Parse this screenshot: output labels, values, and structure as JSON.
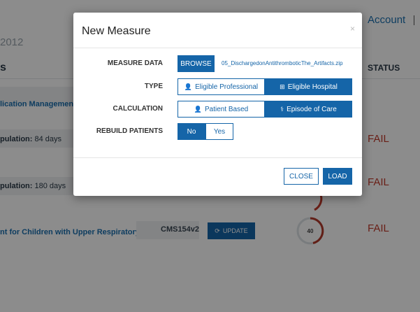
{
  "background": {
    "account_link": "Account",
    "year_fragment": "2012",
    "left_col_fragment": "s",
    "status_header": "STATUS",
    "row1": {
      "title": "lication Management",
      "population": "pulation: 84 days",
      "population_bold": "pulation:",
      "status": "FAIL"
    },
    "row2": {
      "population": "pulation: 180 days",
      "status": "FAIL"
    },
    "row3": {
      "title": "nt for Children with Upper Respiratory",
      "cms": "CMS154v2",
      "update": "UPDATE",
      "gauge": "40",
      "status": "FAIL"
    }
  },
  "modal": {
    "title": "New Measure",
    "close_icon": "×",
    "rows": {
      "measure_data": {
        "label": "MEASURE DATA",
        "browse": "BROWSE",
        "file": "05_DischargedonAntithromboticThe_Artifacts.zip"
      },
      "type": {
        "label": "TYPE",
        "options": [
          "Eligible Professional",
          "Eligible Hospital"
        ],
        "selected": "Eligible Hospital"
      },
      "calculation": {
        "label": "CALCULATION",
        "options": [
          "Patient Based",
          "Episode of Care"
        ],
        "selected": "Episode of Care"
      },
      "rebuild": {
        "label": "REBUILD PATIENTS",
        "options": [
          "No",
          "Yes"
        ],
        "selected": "No"
      }
    },
    "footer": {
      "close": "CLOSE",
      "load": "LOAD"
    }
  },
  "colors": {
    "primary": "#1565a8",
    "fail": "#c0392b",
    "overlay": "rgba(0,0,0,0.45)"
  }
}
